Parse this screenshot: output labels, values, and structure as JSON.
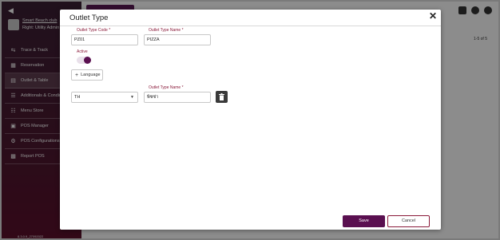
{
  "sidebar": {
    "org_name": "Smart Beach club",
    "user_label": "Right: Utility Admin",
    "version": "8.3.0.9_27092022",
    "items": [
      {
        "label": "Trace & Track",
        "icon": "route-icon"
      },
      {
        "label": "Reservation",
        "icon": "calendar-icon"
      },
      {
        "label": "Outlet & Table",
        "icon": "table-icon"
      },
      {
        "label": "Additionals & Condime",
        "icon": "list-icon"
      },
      {
        "label": "Menu Store",
        "icon": "menu-icon"
      },
      {
        "label": "POS Manager",
        "icon": "pos-icon"
      },
      {
        "label": "POS Configurations",
        "icon": "settings-icon"
      },
      {
        "label": "Report POS",
        "icon": "report-icon"
      }
    ]
  },
  "main": {
    "pager": "1-5 of 5"
  },
  "modal": {
    "title": "Outlet Type",
    "code_label": "Outlet Type Code *",
    "code_value": "PZ01",
    "name_label": "Outlet Type Name *",
    "name_value": "PIZZA",
    "active_label": "Active",
    "active": true,
    "language_button": "Language",
    "lang_select_value": "TH",
    "lang_name_label": "Outlet Type Name *",
    "lang_name_value": "พิซซ่า",
    "save_label": "Save",
    "cancel_label": "Cancel"
  },
  "colors": {
    "accent": "#5a1050",
    "label": "#8a1a3a"
  }
}
